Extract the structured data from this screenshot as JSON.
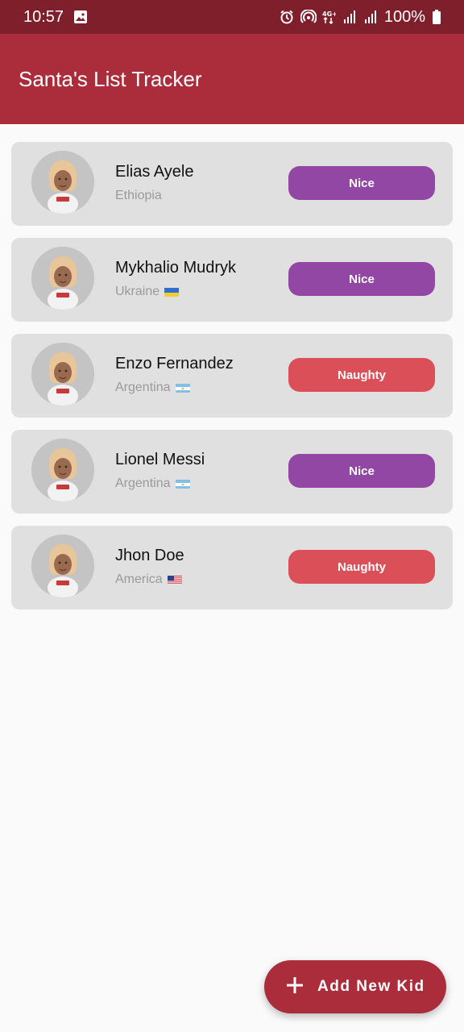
{
  "status_bar": {
    "time": "10:57",
    "battery": "100%"
  },
  "app_bar": {
    "title": "Santa's List Tracker"
  },
  "kids": [
    {
      "name": "Elias Ayele",
      "country": "Ethiopia",
      "flag": "",
      "status": "Nice",
      "status_color": "#9347a4"
    },
    {
      "name": "Mykhalio Mudryk",
      "country": "Ukraine",
      "flag": "ukraine-flag",
      "status": "Nice",
      "status_color": "#9347a4"
    },
    {
      "name": "Enzo Fernandez",
      "country": "Argentina",
      "flag": "argentina-flag",
      "status": "Naughty",
      "status_color": "#db4f59"
    },
    {
      "name": "Lionel Messi",
      "country": "Argentina",
      "flag": "argentina-flag",
      "status": "Nice",
      "status_color": "#9347a4"
    },
    {
      "name": "Jhon Doe",
      "country": "America",
      "flag": "usa-flag",
      "status": "Naughty",
      "status_color": "#db4f59"
    }
  ],
  "fab": {
    "label": "Add New Kid",
    "icon": "plus-icon"
  },
  "colors": {
    "primary": "#ab2d3b",
    "status_bar": "#7f1f2b",
    "nice": "#9347a4",
    "naughty": "#db4f59",
    "card": "#e0e0e0"
  }
}
